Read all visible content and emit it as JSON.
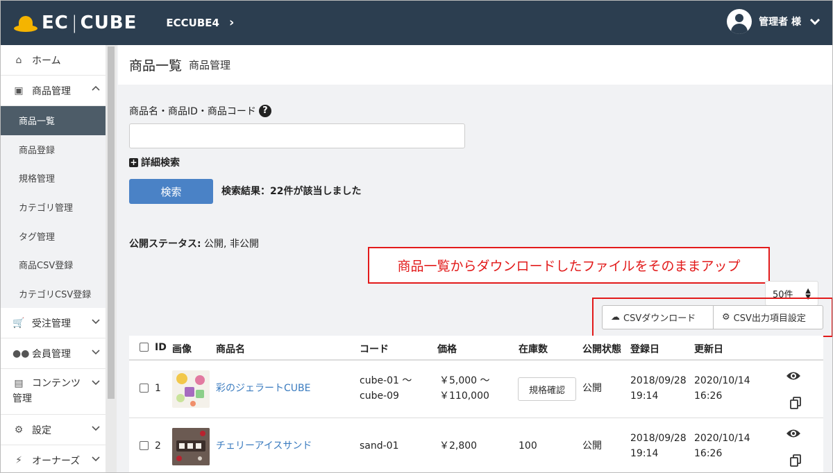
{
  "header": {
    "logo_left": "EC",
    "logo_right": "CUBE",
    "shop_name": "ECCUBE4",
    "user_name": "管理者 様"
  },
  "sidebar": {
    "items": [
      {
        "label": "ホーム",
        "icon": "home-icon"
      },
      {
        "label": "商品管理",
        "icon": "box-icon",
        "expanded": true
      },
      {
        "label": "受注管理",
        "icon": "cart-icon"
      },
      {
        "label": "会員管理",
        "icon": "users-icon"
      },
      {
        "label": "コンテンツ",
        "label2": "管理",
        "icon": "file-icon"
      },
      {
        "label": "設定",
        "icon": "gear-icon"
      },
      {
        "label": "オーナーズ",
        "icon": "plug-icon"
      }
    ],
    "sub_items": [
      "商品一覧",
      "商品登録",
      "規格管理",
      "カテゴリ管理",
      "タグ管理",
      "商品CSV登録",
      "カテゴリCSV登録"
    ],
    "active_sub": "商品一覧"
  },
  "page": {
    "title": "商品一覧",
    "subtitle": "商品管理"
  },
  "search": {
    "label": "商品名・商品ID・商品コード",
    "value": "",
    "advanced_label": "詳細検索",
    "button_label": "検索",
    "result_text": "検索結果：22件が該当しました"
  },
  "status": {
    "label": "公開ステータス:",
    "value": " 公開, 非公開"
  },
  "annotation": {
    "text": "商品一覧からダウンロードしたファイルをそのままアップ",
    "color": "#e21a1a"
  },
  "toolbar": {
    "per_page": "50件",
    "csv_download": "CSVダウンロード",
    "csv_settings": "CSV出力項目設定"
  },
  "table": {
    "columns": [
      "ID",
      "画像",
      "商品名",
      "コード",
      "価格",
      "在庫数",
      "公開状態",
      "登録日",
      "更新日"
    ],
    "rows": [
      {
        "id": "1",
        "name": "彩のジェラートCUBE",
        "code_line1": "cube-01 ～",
        "code_line2": "cube-09",
        "price_line1": "￥5,000 ～",
        "price_line2": "￥110,000",
        "stock": "規格確認",
        "status": "公開",
        "created_date": "2018/09/28",
        "created_time": "19:14",
        "updated_date": "2020/10/14",
        "updated_time": "16:26"
      },
      {
        "id": "2",
        "name": "チェリーアイスサンド",
        "code_line1": "sand-01",
        "price_line1": "￥2,800",
        "stock": "100",
        "status": "公開",
        "created_date": "2018/09/28",
        "created_time": "19:14",
        "updated_date": "2020/10/14",
        "updated_time": "16:26"
      }
    ]
  },
  "colors": {
    "header_bg": "#2c3e50",
    "accent": "#4a82c6",
    "link": "#3a7bbf",
    "active_nav": "#4d5c68",
    "logo_gold": "#f5b400"
  }
}
